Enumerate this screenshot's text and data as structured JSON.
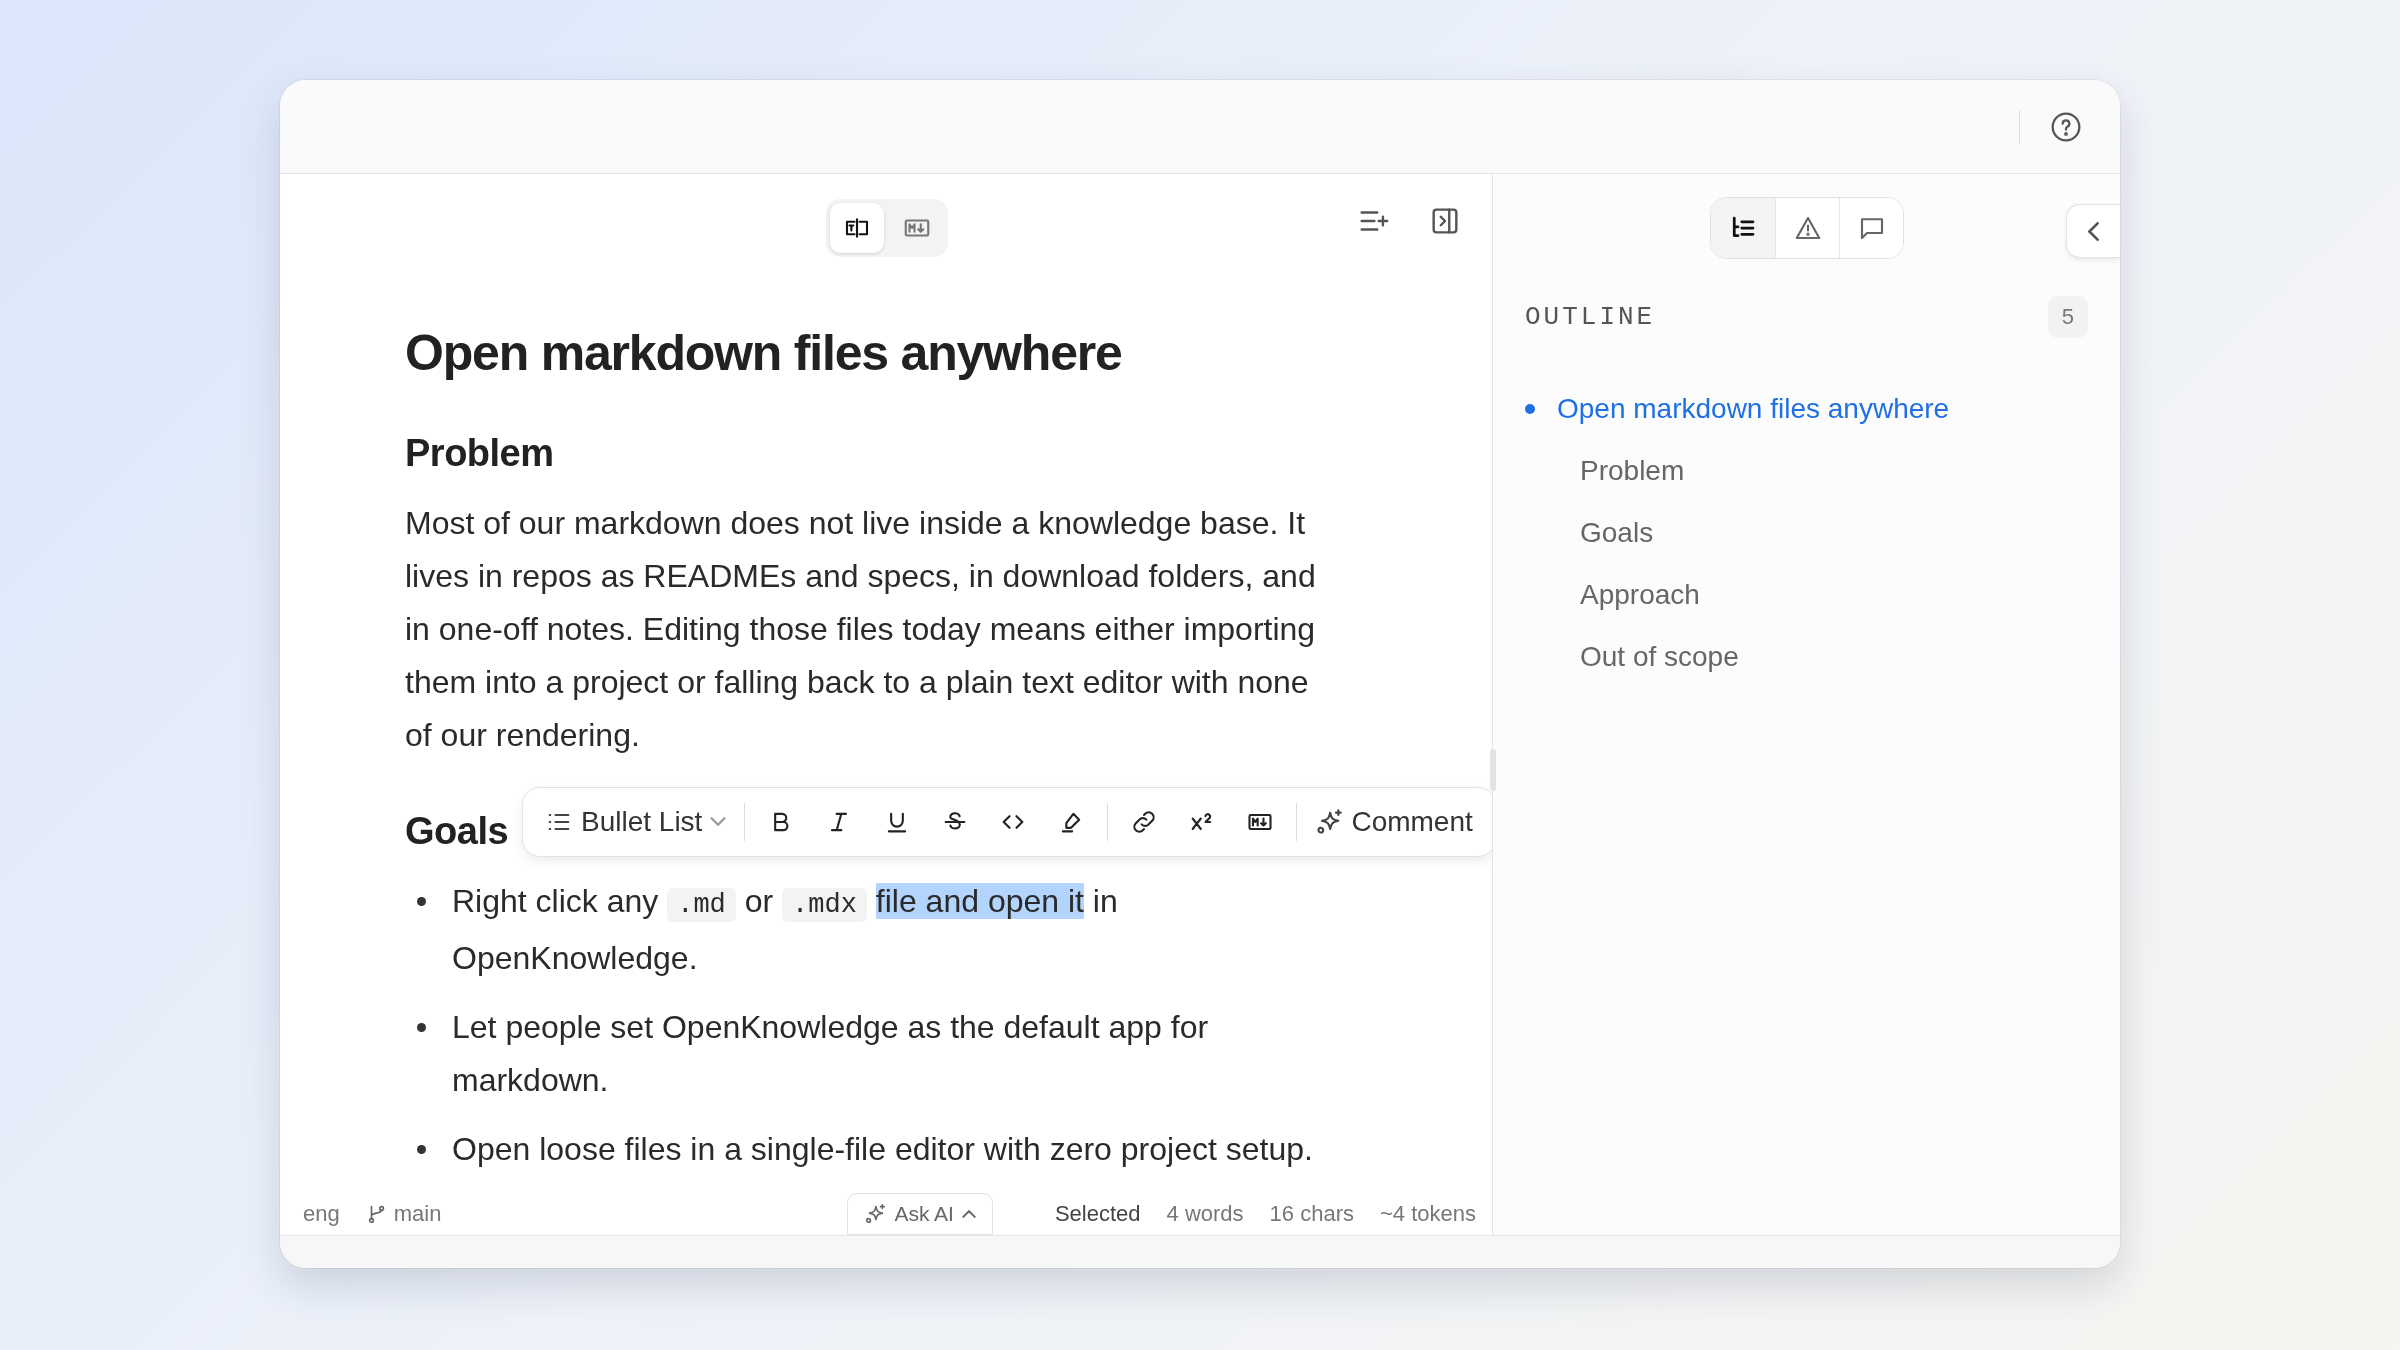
{
  "editor": {
    "view_modes": [
      {
        "kind": "rich",
        "selected": true
      },
      {
        "kind": "markdown",
        "selected": false
      }
    ]
  },
  "document": {
    "title": "Open markdown files anywhere",
    "sections": [
      {
        "heading": "Problem",
        "paragraph": "Most of our markdown does not live inside a knowledge base. It lives in repos as READMEs and specs, in download folders, and in one-off notes. Editing those files today means either importing them into a project or falling back to a plain text editor with none of our rendering."
      },
      {
        "heading": "Goals",
        "bullets": [
          {
            "segments": [
              {
                "kind": "text",
                "text": "Right click any "
              },
              {
                "kind": "code",
                "text": ".md"
              },
              {
                "kind": "text",
                "text": " or "
              },
              {
                "kind": "code",
                "text": ".mdx"
              },
              {
                "kind": "selected",
                "text": "file and open it"
              },
              {
                "kind": "text",
                "text": " in OpenKnowledge."
              }
            ]
          },
          {
            "segments": [
              {
                "kind": "text",
                "text": "Let people set OpenKnowledge as the default app for markdown."
              }
            ]
          },
          {
            "segments": [
              {
                "kind": "text",
                "text": "Open loose files in a single-file editor with zero project setup."
              }
            ]
          }
        ]
      }
    ]
  },
  "format_toolbar": {
    "block_type": "Bullet List",
    "comment": "Comment"
  },
  "status_bar": {
    "language": "eng",
    "branch": "main",
    "ask_ai": "Ask AI",
    "selection_label": "Selected",
    "words": "4 words",
    "chars": "16 chars",
    "tokens": "~4 tokens"
  },
  "panel": {
    "tabs": [
      {
        "kind": "outline",
        "selected": true
      },
      {
        "kind": "warnings",
        "selected": false
      },
      {
        "kind": "comments",
        "selected": false
      }
    ],
    "outline": {
      "title": "OUTLINE",
      "count": "5",
      "items": [
        {
          "label": "Open markdown files anywhere",
          "selected": true,
          "children": [
            {
              "label": "Problem",
              "selected": false
            },
            {
              "label": "Goals",
              "selected": false
            },
            {
              "label": "Approach",
              "selected": false
            },
            {
              "label": "Out of scope",
              "selected": false
            }
          ]
        }
      ]
    }
  }
}
